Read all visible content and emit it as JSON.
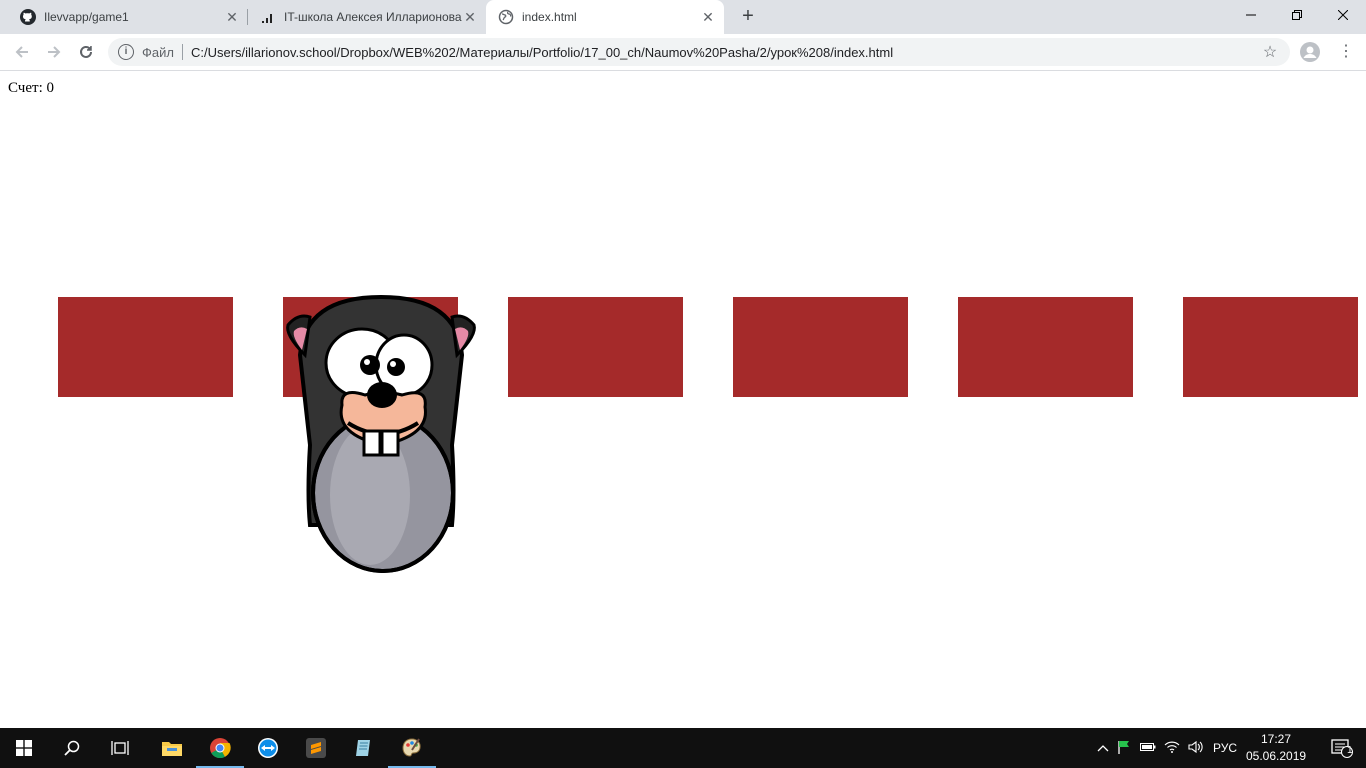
{
  "browser": {
    "tabs": [
      {
        "title": "Ilevvapp/game1",
        "icon": "github-icon"
      },
      {
        "title": "IT-школа Алексея Илларионова",
        "icon": "signal-bars-icon"
      },
      {
        "title": "index.html",
        "icon": "globe-icon"
      }
    ],
    "close_glyph": "✕",
    "new_tab_glyph": "+",
    "omnibox": {
      "scheme_label": "Файл",
      "url": "C:/Users/illarionov.school/Dropbox/WEB%202/Материалы/Portfolio/17_00_ch/Naumov%20Pasha/2/урок%208/index.html"
    }
  },
  "game": {
    "score_label": "Счет: 0",
    "hole_count": 6,
    "hole_color": "#a52a2a",
    "mole_hole_index": 1
  },
  "taskbar": {
    "language": "РУС",
    "time": "17:27",
    "date": "05.06.2019",
    "notification_count": "1"
  }
}
